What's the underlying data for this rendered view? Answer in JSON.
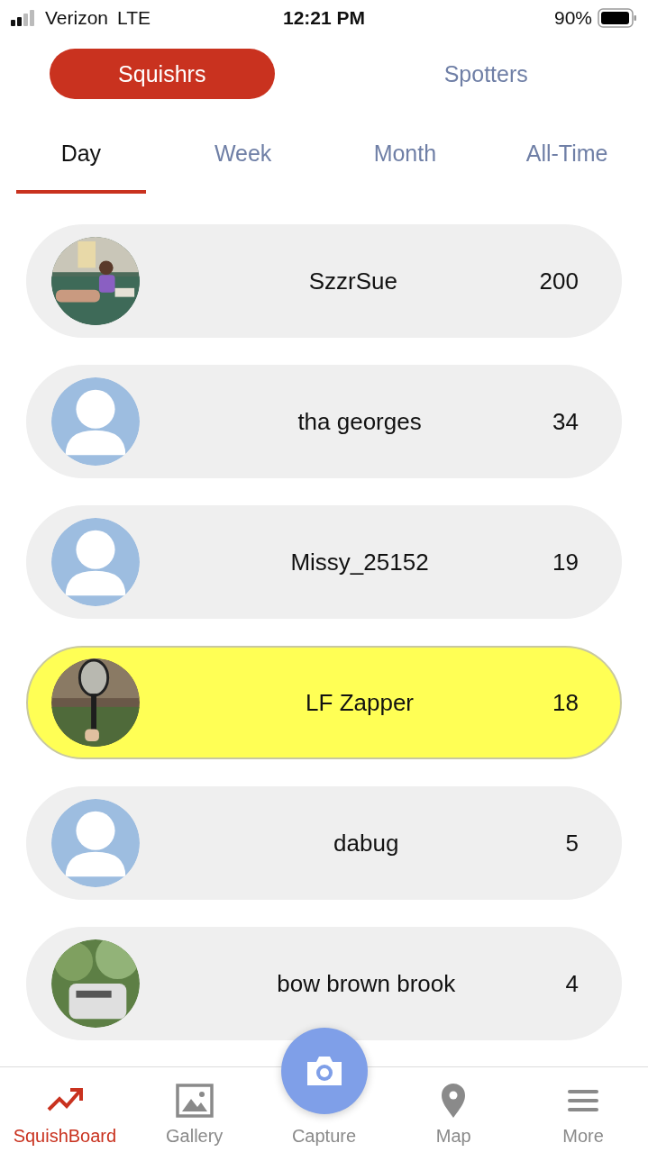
{
  "status_bar": {
    "carrier": "Verizon",
    "network": "LTE",
    "time": "12:21 PM",
    "battery": "90%"
  },
  "segments": [
    {
      "label": "Squishrs",
      "selected": true
    },
    {
      "label": "Spotters",
      "selected": false
    }
  ],
  "periods": [
    {
      "label": "Day",
      "selected": true
    },
    {
      "label": "Week",
      "selected": false
    },
    {
      "label": "Month",
      "selected": false
    },
    {
      "label": "All-Time",
      "selected": false
    }
  ],
  "leaderboard": [
    {
      "name": "SzzrSue",
      "score": "200",
      "selected": false
    },
    {
      "name": "tha georges",
      "score": "34",
      "kind": "default",
      "selected": false
    },
    {
      "name": "Missy_25152",
      "score": "19",
      "kind": "default",
      "selected": false
    },
    {
      "name": "LF Zapper",
      "score": "18",
      "selected": true
    },
    {
      "name": "dabug",
      "score": "5",
      "kind": "default",
      "selected": false
    },
    {
      "name": "bow brown brook",
      "score": "4",
      "selected": false
    }
  ],
  "tab_bar": [
    {
      "label": "SquishBoard",
      "kind": "board",
      "selected": true
    },
    {
      "label": "Gallery",
      "kind": "gallery",
      "selected": false
    },
    {
      "label": "Capture",
      "kind": "capture",
      "selected": false
    },
    {
      "label": "Map",
      "kind": "map",
      "selected": false
    },
    {
      "label": "More",
      "kind": "more",
      "selected": false
    }
  ]
}
